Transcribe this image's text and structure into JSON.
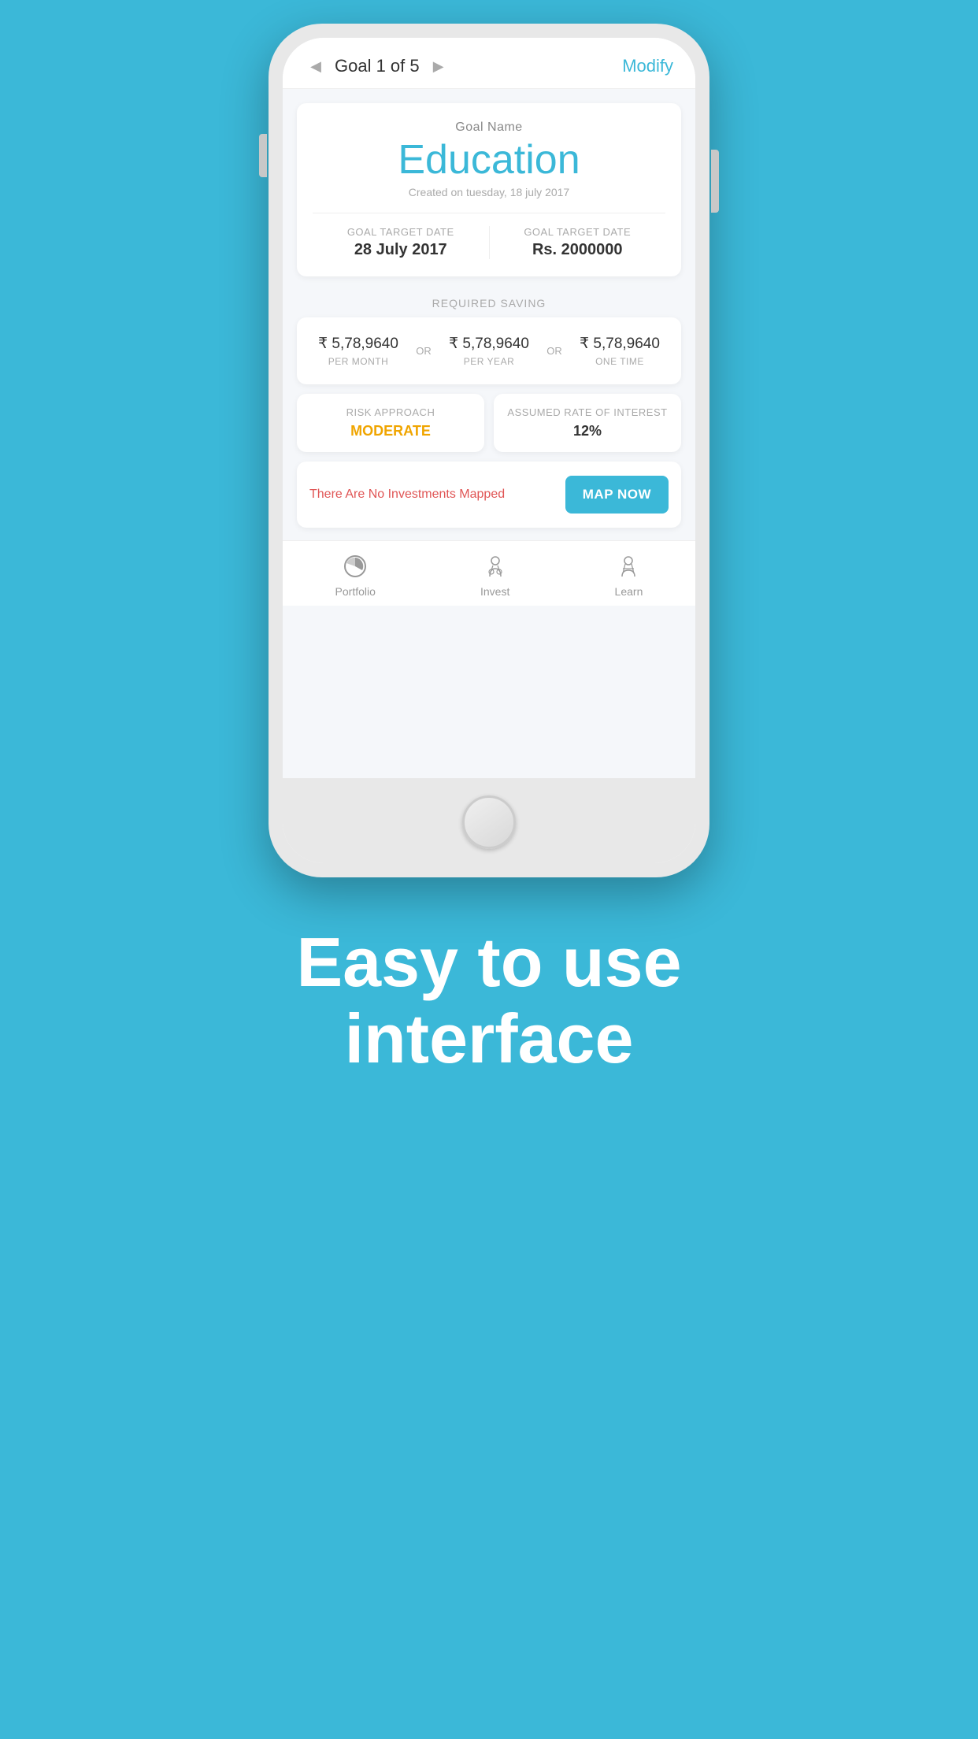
{
  "nav": {
    "goal_counter": "Goal 1 of 5",
    "modify_label": "Modify",
    "left_arrow": "◀",
    "right_arrow": "▶"
  },
  "goal": {
    "name_label": "Goal Name",
    "name": "Education",
    "created": "Created on tuesday, 18 july 2017",
    "target_date_label": "GOAL TARGET DATE",
    "target_date_value": "28 July 2017",
    "target_amount_label": "GOAL TARGET DATE",
    "target_amount_value": "Rs. 2000000"
  },
  "required_saving": {
    "section_label": "REQUIRED SAVING",
    "amount1": "₹ 5,78,9640",
    "period1": "PER MONTH",
    "or1": "OR",
    "amount2": "₹ 5,78,9640",
    "period2": "PER YEAR",
    "or2": "OR",
    "amount3": "₹ 5,78,9640",
    "period3": "ONE TIME"
  },
  "risk": {
    "label": "RISK APPROACH",
    "value": "MODERATE"
  },
  "interest": {
    "label": "ASSUMED RATE OF INTEREST",
    "value": "12%"
  },
  "investments": {
    "message": "There Are No Investments Mapped",
    "map_btn": "MAP NOW"
  },
  "bottom_nav": {
    "portfolio_label": "Portfolio",
    "invest_label": "Invest",
    "learn_label": "Learn"
  },
  "headline": {
    "line1": "Easy to use",
    "line2": "interface"
  }
}
